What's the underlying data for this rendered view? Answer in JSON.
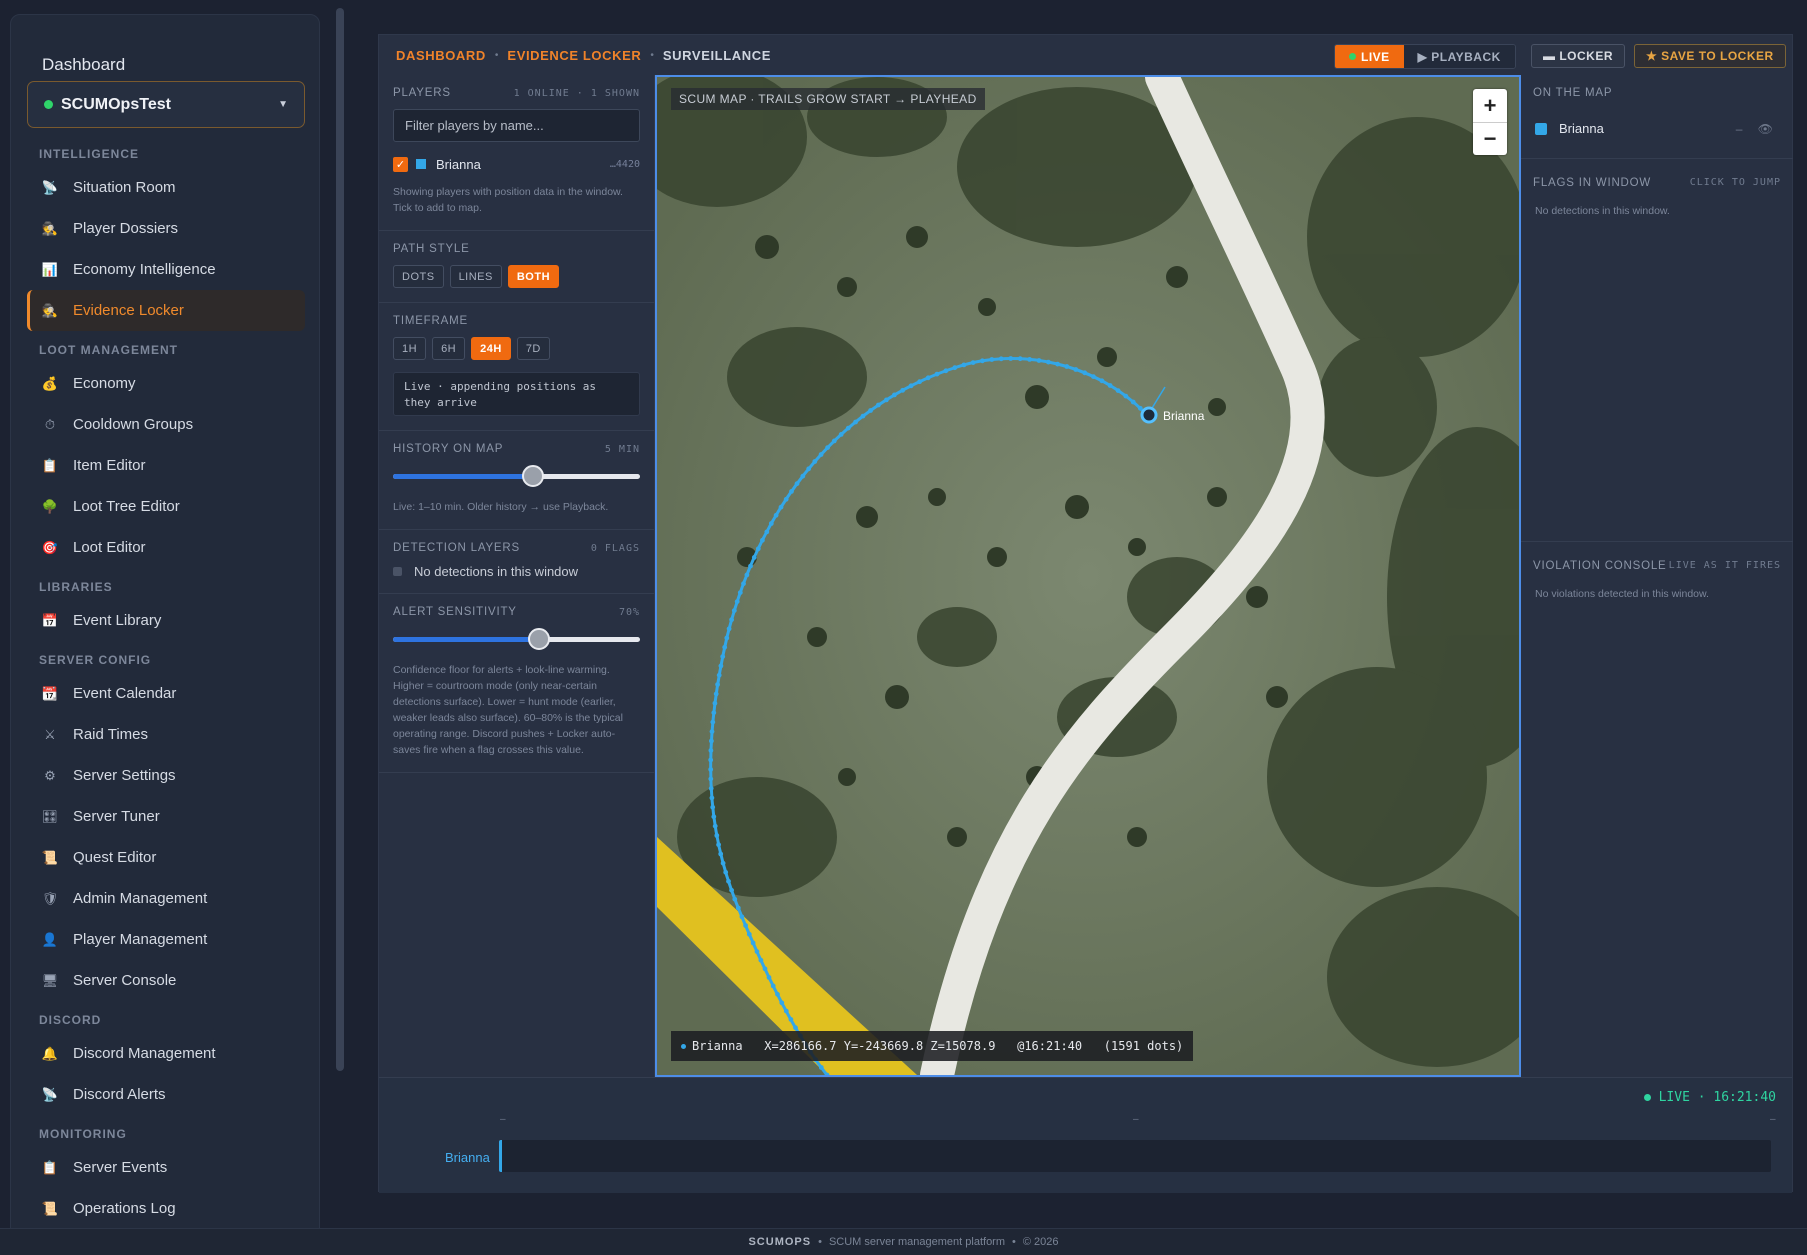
{
  "sidebar": {
    "title": "Dashboard",
    "server": "SCUMOpsTest",
    "groups": [
      {
        "label": "INTELLIGENCE",
        "items": [
          {
            "label": "Situation Room",
            "icon": "radar-icon"
          },
          {
            "label": "Player Dossiers",
            "icon": "dossier-icon"
          },
          {
            "label": "Economy Intelligence",
            "icon": "bar-chart-icon"
          },
          {
            "label": "Evidence Locker",
            "icon": "detective-icon",
            "active": true
          }
        ]
      },
      {
        "label": "LOOT MANAGEMENT",
        "items": [
          {
            "label": "Economy",
            "icon": "money-bag-icon"
          },
          {
            "label": "Cooldown Groups",
            "icon": "stopwatch-icon"
          },
          {
            "label": "Item Editor",
            "icon": "clipboard-icon"
          },
          {
            "label": "Loot Tree Editor",
            "icon": "tree-icon"
          },
          {
            "label": "Loot Editor",
            "icon": "target-icon"
          }
        ]
      },
      {
        "label": "LIBRARIES",
        "items": [
          {
            "label": "Event Library",
            "icon": "calendar-icon"
          }
        ]
      },
      {
        "label": "SERVER CONFIG",
        "items": [
          {
            "label": "Event Calendar",
            "icon": "calendar-31-icon"
          },
          {
            "label": "Raid Times",
            "icon": "crossed-swords-icon"
          },
          {
            "label": "Server Settings",
            "icon": "gear-icon"
          },
          {
            "label": "Server Tuner",
            "icon": "sliders-icon"
          },
          {
            "label": "Quest Editor",
            "icon": "scroll-icon"
          },
          {
            "label": "Admin Management",
            "icon": "shield-icon"
          },
          {
            "label": "Player Management",
            "icon": "user-icon"
          },
          {
            "label": "Server Console",
            "icon": "monitor-icon"
          }
        ]
      },
      {
        "label": "DISCORD",
        "items": [
          {
            "label": "Discord Management",
            "icon": "bell-icon"
          },
          {
            "label": "Discord Alerts",
            "icon": "satellite-icon"
          }
        ]
      },
      {
        "label": "MONITORING",
        "items": [
          {
            "label": "Server Events",
            "icon": "clipboard-icon"
          },
          {
            "label": "Operations Log",
            "icon": "scroll-icon"
          }
        ]
      }
    ]
  },
  "breadcrumb": {
    "root": "DASHBOARD",
    "section": "EVIDENCE LOCKER",
    "current": "SURVEILLANCE"
  },
  "toolbar": {
    "live": "LIVE",
    "playback": "▶ PLAYBACK",
    "locker": "▬ LOCKER",
    "save": "★ SAVE TO LOCKER"
  },
  "players": {
    "header": "PLAYERS",
    "counts": "1 ONLINE · 1 SHOWN",
    "filter_placeholder": "Filter players by name...",
    "list": [
      {
        "name": "Brianna",
        "id": "…4420",
        "color": "#33a7e8",
        "checked": true
      }
    ],
    "hint": "Showing players with position data in the window. Tick to add to map."
  },
  "path_style": {
    "header": "PATH STYLE",
    "options": [
      "DOTS",
      "LINES",
      "BOTH"
    ],
    "selected": "BOTH"
  },
  "timeframe": {
    "header": "TIMEFRAME",
    "options": [
      "1H",
      "6H",
      "24H",
      "7D"
    ],
    "selected": "24H",
    "note": "Live · appending positions as they arrive"
  },
  "history": {
    "header": "HISTORY ON MAP",
    "value_label": "5 MIN",
    "fraction": 0.65,
    "hint": "Live: 1–10 min. Older history → use Playback."
  },
  "detection": {
    "header": "DETECTION LAYERS",
    "flags": "0 FLAGS",
    "empty": "No detections in this window"
  },
  "sensitivity": {
    "header": "ALERT SENSITIVITY",
    "value_label": "70%",
    "fraction": 0.68,
    "description": "Confidence floor for alerts + look-line warming. Higher = courtroom mode (only near-certain detections surface). Lower = hunt mode (earlier, weaker leads also surface). 60–80% is the typical operating range. Discord pushes + Locker auto-saves fire when a flag crosses this value."
  },
  "map": {
    "label": "SCUM MAP · TRAILS GROW START → PLAYHEAD",
    "zoom_in": "+",
    "zoom_out": "−",
    "marker_label": "Brianna",
    "trail_color": "#33a7e8",
    "readout": "Brianna   X=286166.7 Y=-243669.8 Z=15078.9   @16:21:40   (1591 dots)"
  },
  "right": {
    "on_map_header": "ON THE MAP",
    "on_map": [
      {
        "name": "Brianna",
        "tools": "– 👁"
      }
    ],
    "flags_header": "FLAGS IN WINDOW",
    "flags_hint": "CLICK TO JUMP",
    "flags_empty": "No detections in this window.",
    "console_header": "VIOLATION CONSOLE",
    "console_hint": "LIVE AS IT FIRES",
    "console_empty": "No violations detected in this window."
  },
  "timeline": {
    "live": "LIVE · 16:21:40",
    "tick": "–",
    "player": "Brianna"
  },
  "footer": {
    "brand": "SCUMOPS",
    "tagline": "SCUM server management platform",
    "copyright": "© 2026"
  },
  "icons": {
    "glyphs": {
      "radar-icon": "📡",
      "dossier-icon": "🕵",
      "bar-chart-icon": "📊",
      "detective-icon": "🕵",
      "money-bag-icon": "💰",
      "stopwatch-icon": "⏱",
      "clipboard-icon": "📋",
      "tree-icon": "🌳",
      "target-icon": "🎯",
      "calendar-icon": "📅",
      "calendar-31-icon": "📆",
      "crossed-swords-icon": "⚔",
      "gear-icon": "⚙",
      "sliders-icon": "🎛",
      "scroll-icon": "📜",
      "shield-icon": "🛡",
      "user-icon": "👤",
      "monitor-icon": "🖥",
      "bell-icon": "🔔",
      "satellite-icon": "📡"
    }
  }
}
